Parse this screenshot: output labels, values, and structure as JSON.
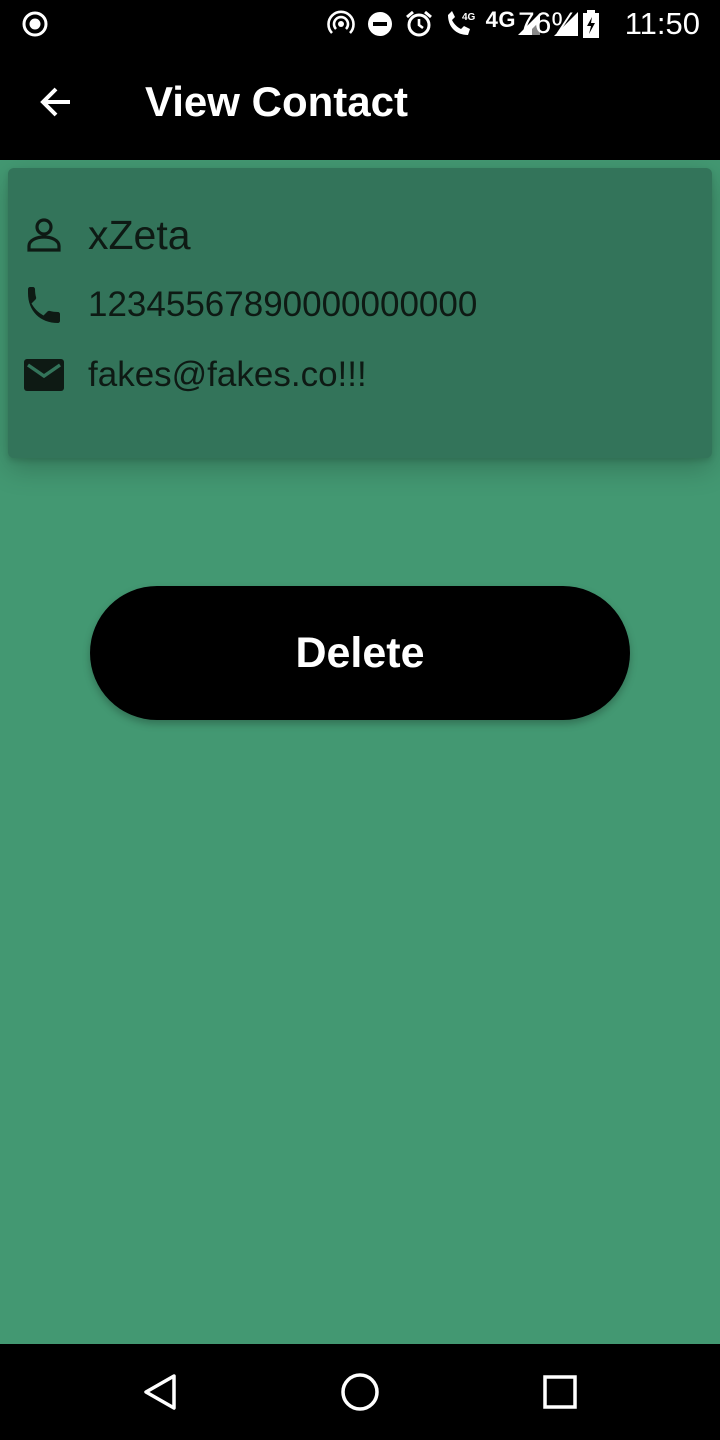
{
  "status_bar": {
    "network_label": "4G",
    "call_badge": "4G",
    "battery_percent": "76%",
    "time": "11:50",
    "icons": [
      "record-icon",
      "hotspot-icon",
      "do-not-disturb-icon",
      "alarm-icon",
      "wifi-call-icon",
      "signal-4g-icon",
      "signal-icon",
      "battery-charging-icon"
    ]
  },
  "app_bar": {
    "title": "View Contact",
    "back_icon": "arrow-back-icon"
  },
  "contact": {
    "name": "xZeta",
    "phone": "12345567890000000000",
    "email": "fakes@fakes.co!!!"
  },
  "actions": {
    "delete_label": "Delete"
  },
  "nav_bar": {
    "icons": [
      "nav-back-icon",
      "nav-home-icon",
      "nav-recents-icon"
    ]
  },
  "colors": {
    "background": "#439872",
    "card": "#33745a",
    "bars": "#000000",
    "button": "#000000",
    "button_text": "#ffffff"
  }
}
